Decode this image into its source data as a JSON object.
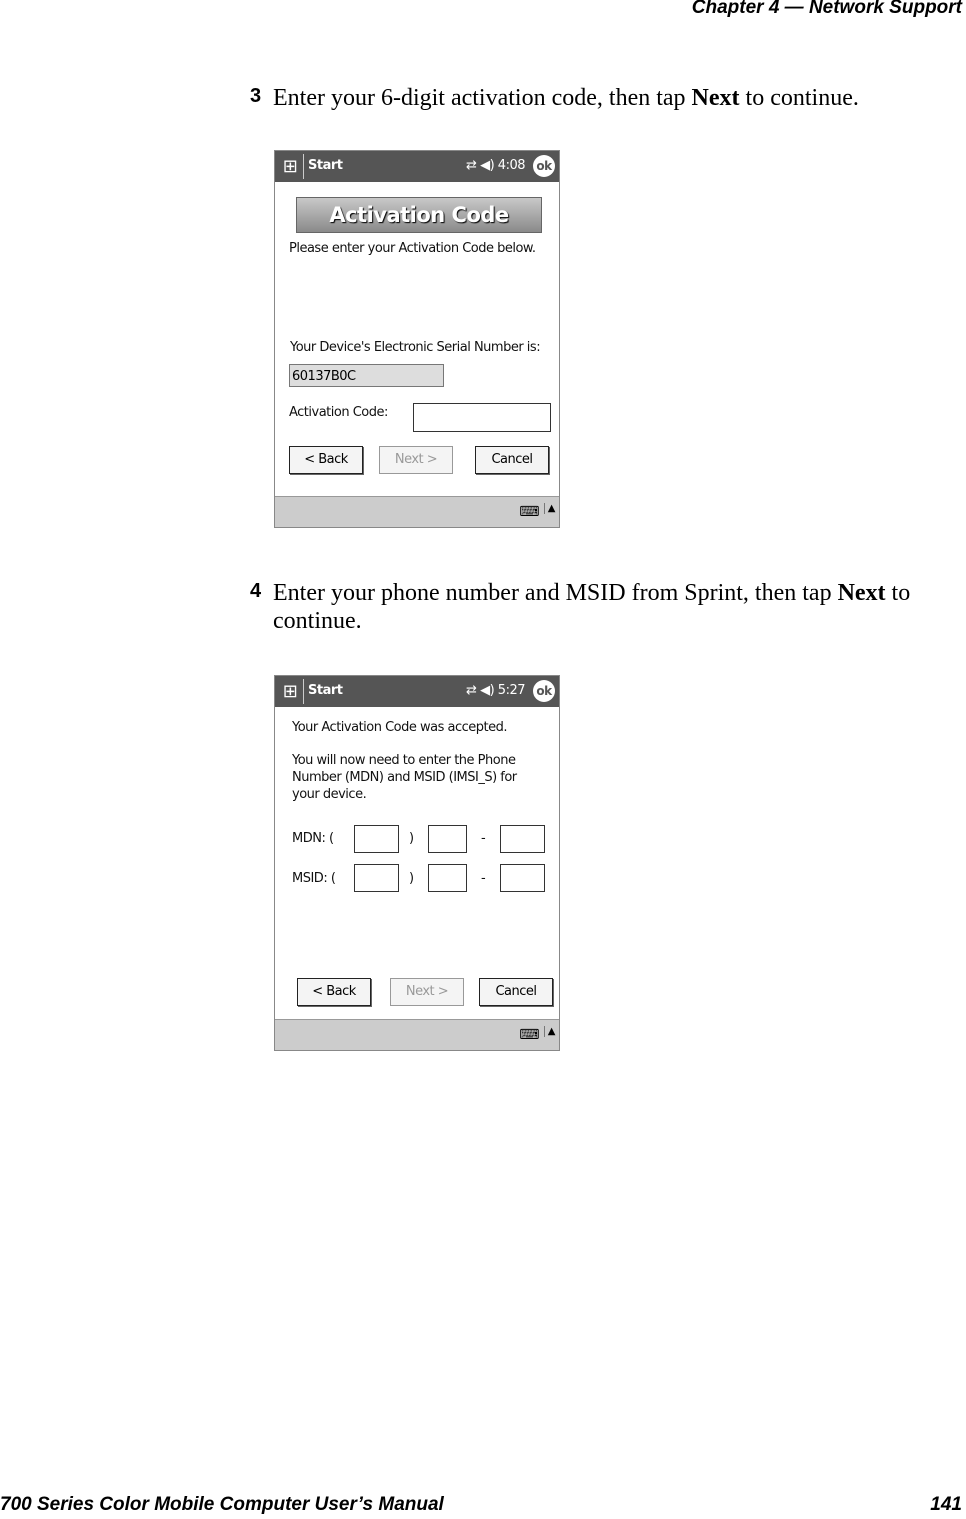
{
  "header": {
    "chapter": "Chapter  4  —  Network Support"
  },
  "steps": [
    {
      "number": "3",
      "text_before": "Enter your 6-digit activation code, then tap ",
      "bold": "Next",
      "text_after": " to continue."
    },
    {
      "number": "4",
      "text_before": "Enter your phone number and MSID from Sprint, then tap ",
      "bold": "Next",
      "text_after": " to continue."
    }
  ],
  "screen1": {
    "start": "Start",
    "time": "4:08",
    "ok": "ok",
    "banner": "Activation Code",
    "prompt": "Please enter your Activation Code below.",
    "serial_label": "Your Device's Electronic Serial Number is:",
    "serial_value": "60137B0C",
    "code_label": "Activation Code:",
    "code_value": "",
    "back": "< Back",
    "next": "Next >",
    "cancel": "Cancel"
  },
  "screen2": {
    "start": "Start",
    "time": "5:27",
    "ok": "ok",
    "msg1": "Your Activation Code was accepted.",
    "msg2_l1": "You will now need to enter the Phone",
    "msg2_l2": "Number (MDN) and MSID (IMSI_S) for",
    "msg2_l3": "your device.",
    "mdn_label": "MDN:  (",
    "msid_label": "MSID:  (",
    "paren_close": ")",
    "dash": "-",
    "back": "< Back",
    "next": "Next >",
    "cancel": "Cancel"
  },
  "footer": {
    "manual": "700 Series Color Mobile Computer User’s Manual",
    "page": "141"
  }
}
